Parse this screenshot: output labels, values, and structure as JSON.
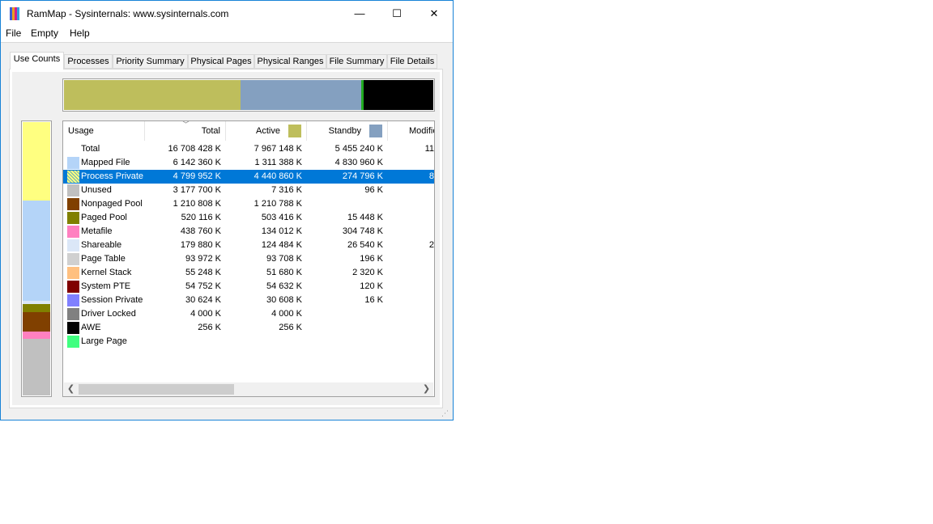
{
  "window": {
    "title": "RamMap - Sysinternals: www.sysinternals.com",
    "minimize": "—",
    "maximize": "☐",
    "close": "✕"
  },
  "menu": {
    "file": "File",
    "empty": "Empty",
    "help": "Help"
  },
  "tabs": [
    {
      "label": "Use Counts"
    },
    {
      "label": "Processes"
    },
    {
      "label": "Priority Summary"
    },
    {
      "label": "Physical Pages"
    },
    {
      "label": "Physical Ranges"
    },
    {
      "label": "File Summary"
    },
    {
      "label": "File Details"
    }
  ],
  "columns": {
    "usage": "Usage",
    "total": "Total",
    "active": "Active",
    "standby": "Standby",
    "modified": "Modifie"
  },
  "colors": {
    "active": "#bebe5c",
    "standby": "#84a0c0",
    "selection": "#0078d7"
  },
  "top_bar": [
    {
      "name": "Active",
      "color": "#bebe5c",
      "fraction": 0.477
    },
    {
      "name": "Standby",
      "color": "#84a0c0",
      "fraction": 0.327
    },
    {
      "name": "Modified",
      "color": "#22aa22",
      "fraction": 0.007
    },
    {
      "name": "Unused",
      "color": "#000000",
      "fraction": 0.189
    }
  ],
  "side_bar": [
    {
      "name": "Process Private",
      "color": "#ffff80",
      "fraction": 0.287
    },
    {
      "name": "Mapped File",
      "color": "#b4d4f8",
      "fraction": 0.368
    },
    {
      "name": "Shareable",
      "color": "#dbe7f7",
      "fraction": 0.011
    },
    {
      "name": "Paged Pool",
      "color": "#808000",
      "fraction": 0.031
    },
    {
      "name": "Nonpaged Pool",
      "color": "#804000",
      "fraction": 0.072
    },
    {
      "name": "Metafile",
      "color": "#ff80c0",
      "fraction": 0.026
    },
    {
      "name": "Unused",
      "color": "#c0c0c0",
      "fraction": 0.205
    }
  ],
  "rows": [
    {
      "usage": "Total",
      "color": "",
      "total": "16 708 428 K",
      "active": "7 967 148 K",
      "standby": "5 455 240 K",
      "modified": "11"
    },
    {
      "usage": "Mapped File",
      "color": "#b4d4f8",
      "total": "6 142 360 K",
      "active": "1 311 388 K",
      "standby": "4 830 960 K",
      "modified": ""
    },
    {
      "usage": "Process Private",
      "color": "#ffff80",
      "total": "4 799 952 K",
      "active": "4 440 860 K",
      "standby": "274 796 K",
      "modified": "8",
      "selected": true
    },
    {
      "usage": "Unused",
      "color": "#c0c0c0",
      "total": "3 177 700 K",
      "active": "7 316 K",
      "standby": "96 K",
      "modified": ""
    },
    {
      "usage": "Nonpaged Pool",
      "color": "#804000",
      "total": "1 210 808 K",
      "active": "1 210 788 K",
      "standby": "",
      "modified": ""
    },
    {
      "usage": "Paged Pool",
      "color": "#808000",
      "total": "520 116 K",
      "active": "503 416 K",
      "standby": "15 448 K",
      "modified": ""
    },
    {
      "usage": "Metafile",
      "color": "#ff80c0",
      "total": "438 760 K",
      "active": "134 012 K",
      "standby": "304 748 K",
      "modified": ""
    },
    {
      "usage": "Shareable",
      "color": "#dbe7f7",
      "total": "179 880 K",
      "active": "124 484 K",
      "standby": "26 540 K",
      "modified": "2"
    },
    {
      "usage": "Page Table",
      "color": "#d0d0d0",
      "total": "93 972 K",
      "active": "93 708 K",
      "standby": "196 K",
      "modified": ""
    },
    {
      "usage": "Kernel Stack",
      "color": "#ffc080",
      "total": "55 248 K",
      "active": "51 680 K",
      "standby": "2 320 K",
      "modified": ""
    },
    {
      "usage": "System PTE",
      "color": "#800000",
      "total": "54 752 K",
      "active": "54 632 K",
      "standby": "120 K",
      "modified": ""
    },
    {
      "usage": "Session Private",
      "color": "#8080ff",
      "total": "30 624 K",
      "active": "30 608 K",
      "standby": "16 K",
      "modified": ""
    },
    {
      "usage": "Driver Locked",
      "color": "#808080",
      "total": "4 000 K",
      "active": "4 000 K",
      "standby": "",
      "modified": ""
    },
    {
      "usage": "AWE",
      "color": "#000000",
      "total": "256 K",
      "active": "256 K",
      "standby": "",
      "modified": ""
    },
    {
      "usage": "Large Page",
      "color": "#40ff80",
      "total": "",
      "active": "",
      "standby": "",
      "modified": ""
    }
  ]
}
